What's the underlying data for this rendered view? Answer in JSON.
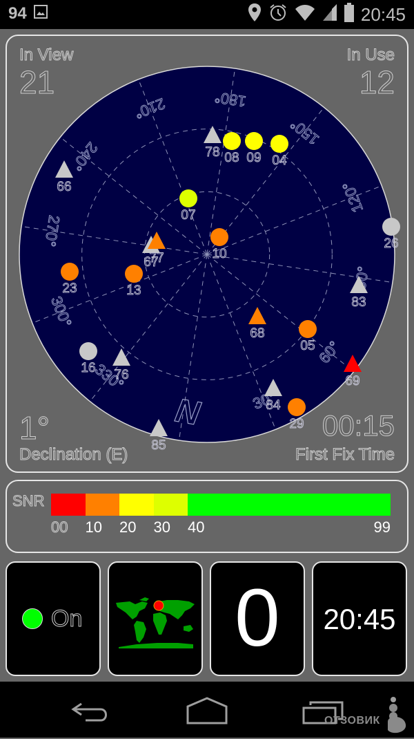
{
  "statusbar": {
    "left_number": "94",
    "left_icons": [
      "image-notification-icon"
    ],
    "right_icons": [
      "location-pin-icon",
      "alarm-clock-icon",
      "wifi-icon",
      "cell-signal-icon",
      "battery-icon"
    ],
    "time": "20:45"
  },
  "skyview": {
    "in_view_label": "In View",
    "in_view_value": "21",
    "in_use_label": "In Use",
    "in_use_value": "12",
    "declination_value": "1°",
    "declination_label": "Declination (E)",
    "first_fix_value": "00:15",
    "first_fix_label": "First Fix Time",
    "north_label": "N",
    "bearing_labels": [
      "30°",
      "60°",
      "90°",
      "120°",
      "150°",
      "180°",
      "210°",
      "240°",
      "270°",
      "300°",
      "330°"
    ],
    "colors": {
      "sky": "#000044",
      "grid": "#8f93b8",
      "snr_gray": "#c8c8c8",
      "snr_red": "#ff0000",
      "snr_orange": "#ff8000",
      "snr_yellow": "#ffff00",
      "snr_yellowgreen": "#ddff00"
    },
    "satellites": [
      {
        "id": "78",
        "shape": "triangle",
        "color": "#c8c8c8"
      },
      {
        "id": "08",
        "shape": "circle",
        "color": "#ffff00"
      },
      {
        "id": "09",
        "shape": "circle",
        "color": "#ffff00"
      },
      {
        "id": "04",
        "shape": "circle",
        "color": "#ffff00"
      },
      {
        "id": "66",
        "shape": "triangle",
        "color": "#c8c8c8"
      },
      {
        "id": "07",
        "shape": "circle",
        "color": "#ddff00"
      },
      {
        "id": "67",
        "shape": "triangle",
        "color": "#c8c8c8"
      },
      {
        "id": "77",
        "shape": "triangle",
        "color": "#ff8000"
      },
      {
        "id": "10",
        "shape": "circle",
        "color": "#ff8000"
      },
      {
        "id": "26",
        "shape": "circle",
        "color": "#c8c8c8"
      },
      {
        "id": "23",
        "shape": "circle",
        "color": "#ff8000"
      },
      {
        "id": "13",
        "shape": "circle",
        "color": "#ff8000"
      },
      {
        "id": "83",
        "shape": "triangle",
        "color": "#c8c8c8"
      },
      {
        "id": "68",
        "shape": "triangle",
        "color": "#ff8000"
      },
      {
        "id": "05",
        "shape": "circle",
        "color": "#ff8000"
      },
      {
        "id": "16",
        "shape": "circle",
        "color": "#c8c8c8"
      },
      {
        "id": "76",
        "shape": "triangle",
        "color": "#c8c8c8"
      },
      {
        "id": "69",
        "shape": "triangle",
        "color": "#ff0000"
      },
      {
        "id": "84",
        "shape": "triangle",
        "color": "#c8c8c8"
      },
      {
        "id": "29",
        "shape": "circle",
        "color": "#ff8000"
      },
      {
        "id": "85",
        "shape": "triangle",
        "color": "#c8c8c8"
      }
    ]
  },
  "snr": {
    "label": "SNR",
    "segments": [
      {
        "from": 0,
        "to": 10,
        "color": "#ff0000"
      },
      {
        "from": 10,
        "to": 20,
        "color": "#ff8000"
      },
      {
        "from": 20,
        "to": 30,
        "color": "#ffff00"
      },
      {
        "from": 30,
        "to": 40,
        "color": "#ddff00"
      },
      {
        "from": 40,
        "to": 99,
        "color": "#00ff00"
      }
    ],
    "ticks": [
      "00",
      "10",
      "20",
      "30",
      "40",
      "99"
    ]
  },
  "tiles": {
    "gps_status_label": "On",
    "gps_status_color": "#00ff00",
    "map_marker_color": "#ff0000",
    "map_land_color": "#00a000",
    "speed_value": "0",
    "clock_value": "20:45"
  },
  "navbar": {
    "buttons": [
      "back",
      "home",
      "recent-apps"
    ],
    "watermark": "ОТЗОВИК"
  }
}
